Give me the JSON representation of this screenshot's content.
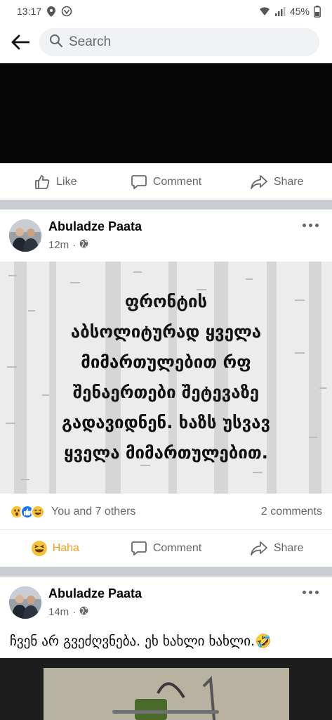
{
  "status_bar": {
    "time": "13:17",
    "battery": "45%",
    "icons": [
      "location-pin-icon",
      "vpn-icon",
      "wifi-icon",
      "signal-icon",
      "battery-icon"
    ]
  },
  "search": {
    "placeholder": "Search",
    "back_icon": "back-arrow-icon"
  },
  "video_actions": {
    "like": "Like",
    "comment": "Comment",
    "share": "Share"
  },
  "post1": {
    "author": "Abuladze Paata",
    "time": "12m",
    "privacy_icon": "globe-icon",
    "caption_lines": [
      "ფრონტის",
      "აბსოლიტურად ყველა",
      "მიმართულებით რფ",
      "შენაერთები შეტევაზე",
      "გადავიდნენ. ხაზს უსვავ",
      "ყველა მიმართულებით."
    ],
    "reactions_text": "You and 7 others",
    "comments_count": "2 comments",
    "reaction_icons": [
      "wow-icon",
      "like-reaction-icon",
      "haha-reaction-icon"
    ],
    "actions": {
      "haha": "Haha",
      "comment": "Comment",
      "share": "Share"
    }
  },
  "post2": {
    "author": "Abuladze Paata",
    "time": "14m",
    "privacy_icon": "globe-icon",
    "text": "ჩვენ არ გვეძღვნება. ეხ ხახლი ხახლი.🤣"
  },
  "colors": {
    "secondary_text": "#65676b",
    "haha_accent": "#f0a020",
    "feed_separator": "#cacdd2"
  }
}
